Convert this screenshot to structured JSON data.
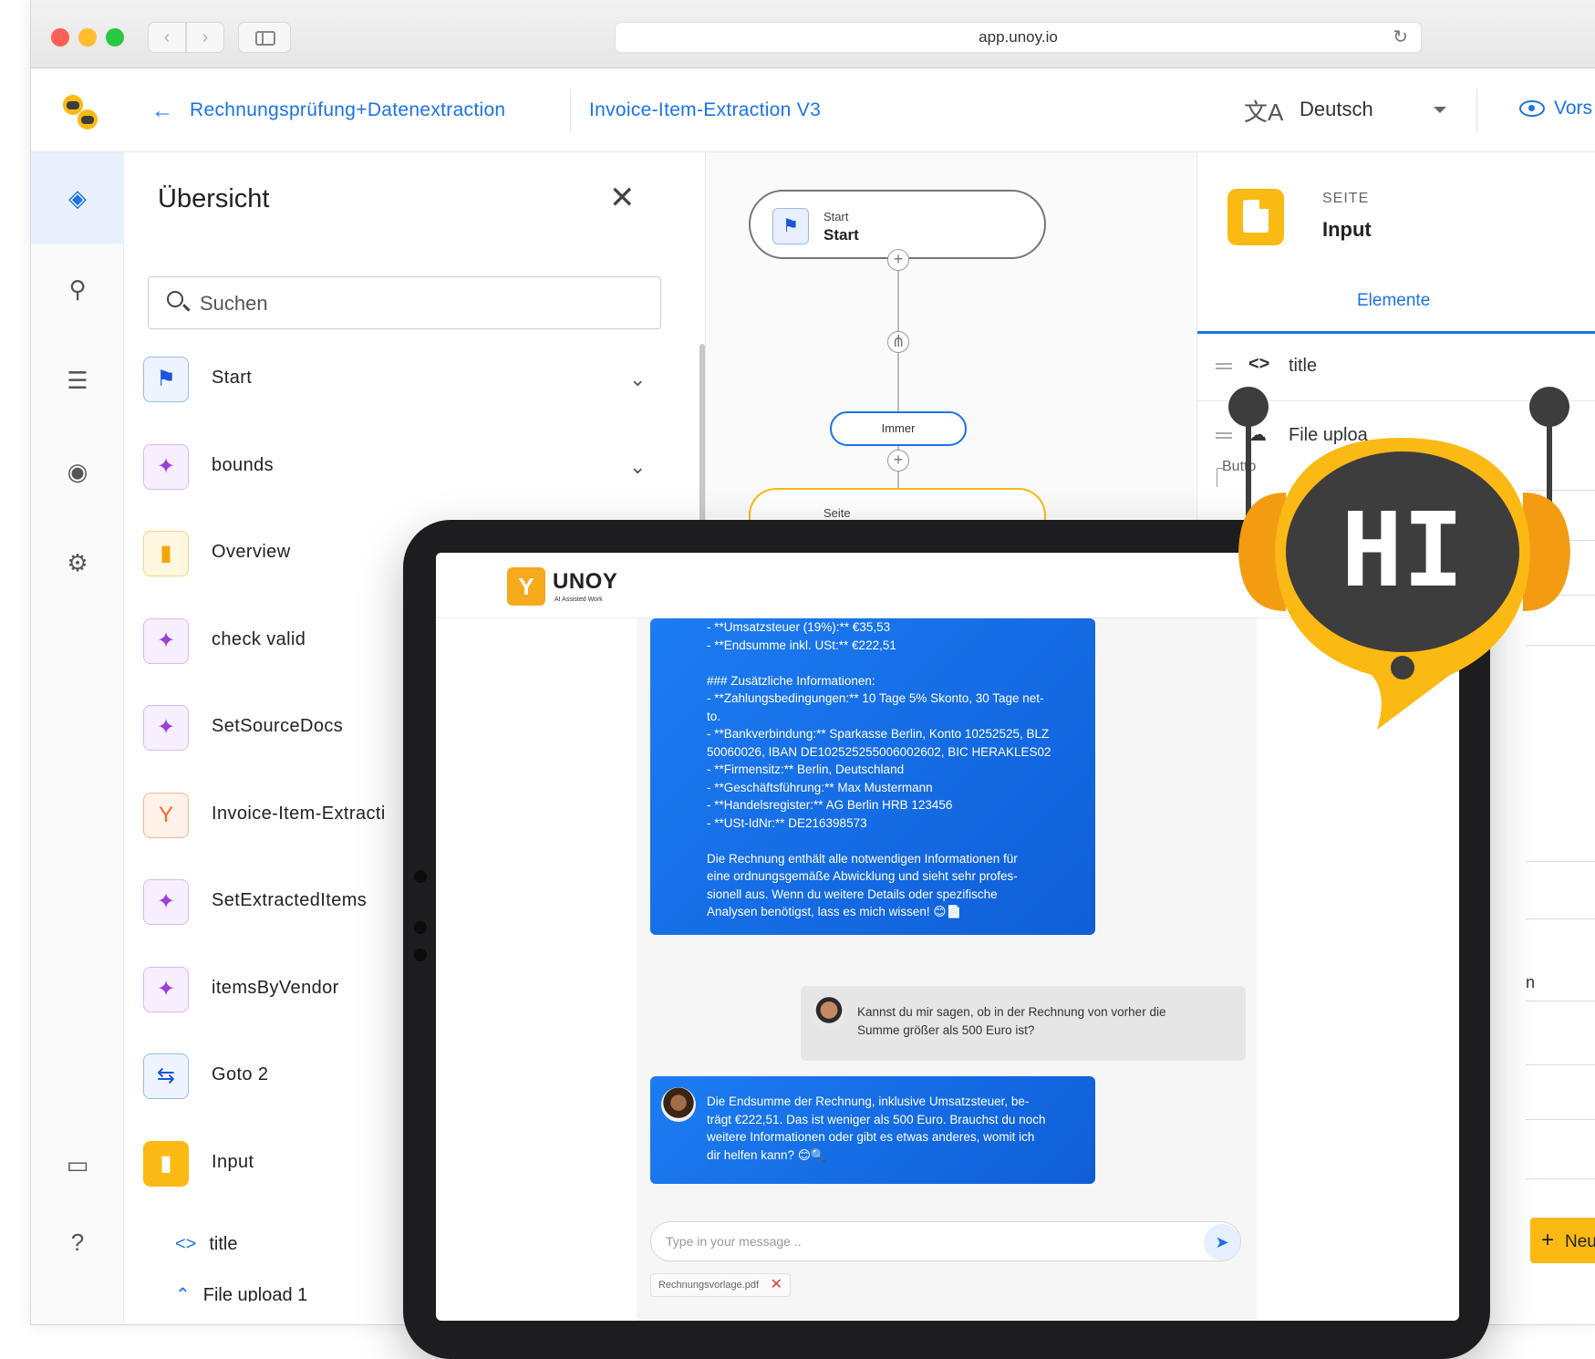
{
  "browser": {
    "url": "app.unoy.io",
    "nav_back": "‹",
    "nav_forward": "›",
    "reload": "↻"
  },
  "appbar": {
    "back_arrow": "←",
    "breadcrumb_project": "Rechnungsprüfung+Datenextraction",
    "breadcrumb_flow": "Invoice-Item-Extraction V3",
    "language": "Deutsch",
    "preview_label": "Vors"
  },
  "rail": {
    "icons": [
      "layers-icon",
      "lightbulb-icon",
      "chat-list-icon",
      "palette-icon",
      "gear-icon",
      "message-icon",
      "help-icon"
    ]
  },
  "overview": {
    "title": "Übersicht",
    "close": "✕",
    "search_placeholder": "Suchen",
    "items": [
      {
        "label": "Start",
        "icon": "flag-icon",
        "glyph": "⚑",
        "style": "blue",
        "expandable": true
      },
      {
        "label": "bounds",
        "icon": "sparkle-icon",
        "glyph": "✦",
        "style": "purple",
        "expandable": true
      },
      {
        "label": "Overview",
        "icon": "page-icon",
        "glyph": "▮",
        "style": "yellow",
        "expandable": false
      },
      {
        "label": "check valid",
        "icon": "sparkle-icon",
        "glyph": "✦",
        "style": "purple",
        "expandable": false
      },
      {
        "label": "SetSourceDocs",
        "icon": "sparkle-icon",
        "glyph": "✦",
        "style": "purple",
        "expandable": false
      },
      {
        "label": "Invoice-Item-Extracti",
        "icon": "unoy-logo-icon",
        "glyph": "Y",
        "style": "orange",
        "expandable": false
      },
      {
        "label": "SetExtractedItems",
        "icon": "sparkle-icon",
        "glyph": "✦",
        "style": "purple",
        "expandable": false
      },
      {
        "label": "itemsByVendor",
        "icon": "sparkle-icon",
        "glyph": "✦",
        "style": "purple",
        "expandable": false
      },
      {
        "label": "Goto 2",
        "icon": "route-icon",
        "glyph": "⇆",
        "style": "blue",
        "expandable": false
      },
      {
        "label": "Input",
        "icon": "page-icon",
        "glyph": "▮",
        "style": "yfill",
        "expandable": false
      }
    ],
    "sub_items": [
      {
        "code": "<>",
        "label": "title"
      },
      {
        "code": "⌃",
        "label": "File upload 1"
      }
    ]
  },
  "canvas": {
    "start_kind": "Start",
    "start_name": "Start",
    "edge_label": "Immer",
    "next_kind": "Seite"
  },
  "right_panel": {
    "kind": "SEITE",
    "name": "Input",
    "tab": "Elemente",
    "rows": [
      {
        "icon": "code-icon",
        "glyph": "<>",
        "label": "title"
      },
      {
        "icon": "cloud-upload-icon",
        "glyph": "☁",
        "label": "File uploa"
      }
    ],
    "sub_label": "Butto",
    "partial_char": "n",
    "new_button": "Neues E"
  },
  "tablet": {
    "brand": "UNOY",
    "brand_tag": "AI Assisted Work",
    "ai_message_1": [
      "- **Umsatzsteuer (19%):** €35,53",
      "- **Endsumme inkl. USt:** €222,51",
      "",
      "### Zusätzliche Informationen:",
      "- **Zahlungsbedingungen:** 10 Tage 5% Skonto, 30 Tage net-",
      "to.",
      "- **Bankverbindung:** Sparkasse Berlin, Konto 10252525, BLZ",
      "50060026, IBAN DE10252525500600260​2, BIC HERAKLES02",
      "- **Firmensitz:** Berlin, Deutschland",
      "- **Geschäftsführung:** Max Mustermann",
      "- **Handelsregister:** AG Berlin HRB 123456",
      "- **USt-IdNr:** DE216398573",
      "",
      "Die Rechnung enthält alle notwendigen Informationen für",
      "eine ordnungsgemäße Abwicklung und sieht sehr profes-",
      "sionell aus. Wenn du weitere Details oder spezifische",
      "Analysen benötigst, lass es mich wissen! 😊📄"
    ],
    "user_message": [
      "Kannst du mir sagen, ob in der Rechnung von vorher die",
      "Summe größer als 500 Euro ist?"
    ],
    "ai_message_2": [
      "Die Endsumme der Rechnung, inklusive Umsatzsteuer, be-",
      "trägt €222,51. Das ist weniger als 500 Euro. Brauchst du noch",
      "weitere Informationen oder gibt es etwas anderes, womit ich",
      "dir helfen kann? 😊🔍"
    ],
    "input_placeholder": "Type in your message ..",
    "send_glyph": "➤",
    "attachment": "Rechnungsvorlage.pdf",
    "attachment_remove": "✕"
  },
  "mascot": {
    "text": "HI",
    "colors": {
      "body": "#fbb913",
      "face": "#3d3d3d",
      "ear": "#f39c12"
    }
  }
}
